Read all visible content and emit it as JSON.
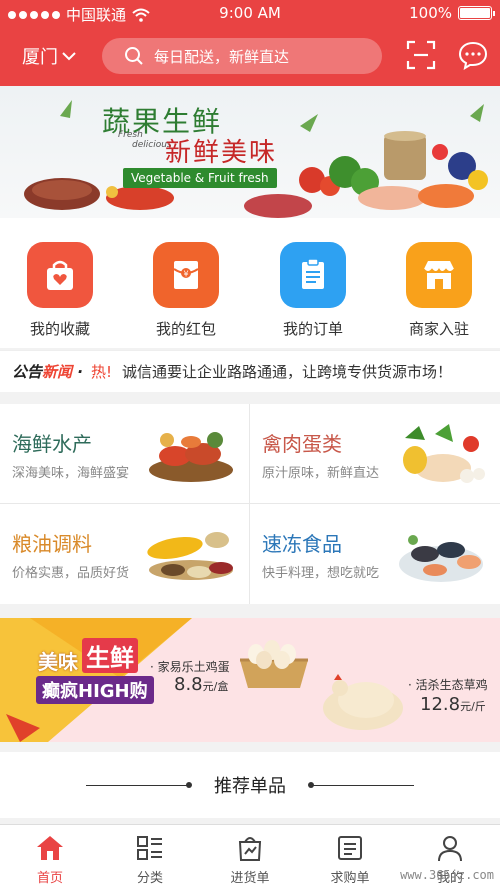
{
  "status": {
    "carrier": "中国联通",
    "time": "9:00 AM",
    "battery": "100%"
  },
  "nav": {
    "city": "厦门",
    "search_placeholder": "每日配送，新鲜直达"
  },
  "banner": {
    "title1": "蔬果生鲜",
    "title2": "新鲜美味",
    "fresh": "Fresh",
    "delicious": "delicious",
    "ribbon": "Vegetable & Fruit fresh"
  },
  "quick": [
    {
      "label": "我的收藏",
      "color": "#f0563e",
      "icon": "bag-heart-icon"
    },
    {
      "label": "我的红包",
      "color": "#f0642c",
      "icon": "red-envelope-icon"
    },
    {
      "label": "我的订单",
      "color": "#2ea1f2",
      "icon": "order-list-icon"
    },
    {
      "label": "商家入驻",
      "color": "#f9a11b",
      "icon": "store-icon"
    }
  ],
  "notice": {
    "logo_a": "公告",
    "logo_b": "新闻",
    "hot": "热!",
    "text": "诚信通要让企业路路通通，让跨境专供货源市场！"
  },
  "categories": [
    {
      "title": "海鲜水产",
      "subtitle": "深海美味，海鲜盛宴",
      "color": "#2e6b5a",
      "icon": "seafood-image"
    },
    {
      "title": "禽肉蛋类",
      "subtitle": "原汁原味，新鲜直达",
      "color": "#c8584a",
      "icon": "poultry-image"
    },
    {
      "title": "粮油调料",
      "subtitle": "价格实惠，品质好货",
      "color": "#d98a2a",
      "icon": "grain-image"
    },
    {
      "title": "速冻食品",
      "subtitle": "快手料理，想吃就吃",
      "color": "#2c77b8",
      "icon": "frozen-food-image"
    }
  ],
  "promo": {
    "badge1": "美味",
    "badge2": "生鲜",
    "badge3": "癫疯HIGH购",
    "item1_name": "家易乐土鸡蛋",
    "item1_price": "8.8",
    "item1_unit": "元/盒",
    "item2_name": "活杀生态草鸡",
    "item2_price": "12.8",
    "item2_unit": "元/斤"
  },
  "recommend": {
    "title": "推荐单品"
  },
  "tabs": [
    {
      "label": "首页",
      "icon": "home-icon",
      "active": true
    },
    {
      "label": "分类",
      "icon": "category-icon",
      "active": false
    },
    {
      "label": "进货单",
      "icon": "purchase-bag-icon",
      "active": false
    },
    {
      "label": "求购单",
      "icon": "request-order-icon",
      "active": false
    },
    {
      "label": "我的",
      "icon": "profile-icon",
      "active": false
    }
  ],
  "watermark": "www.365jz.com"
}
